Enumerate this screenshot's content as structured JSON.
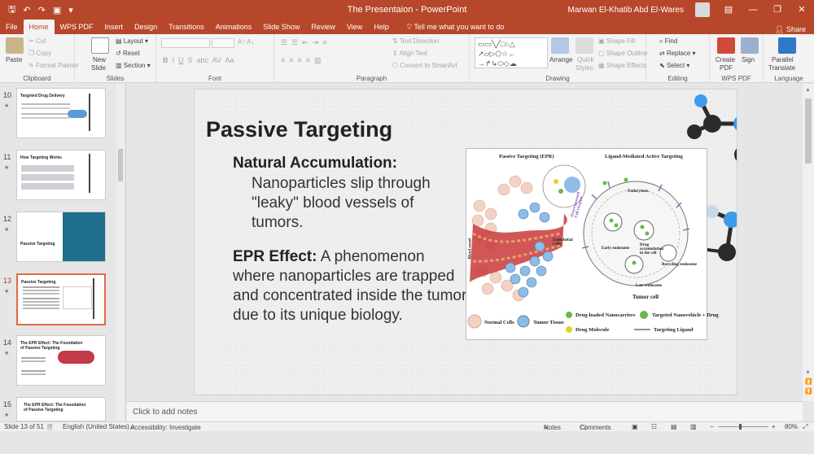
{
  "titlebar": {
    "doc_title": "The Presentaion  -  PowerPoint",
    "user": "Marwan El-Khatib Abd El-Wares",
    "share": "Share"
  },
  "tabs": [
    "File",
    "Home",
    "WPS PDF",
    "Insert",
    "Design",
    "Transitions",
    "Animations",
    "Slide Show",
    "Review",
    "View",
    "Help"
  ],
  "tell_me": "Tell me what you want to do",
  "ribbon": {
    "clipboard": {
      "label": "Clipboard",
      "paste": "Paste",
      "cut": "Cut",
      "copy": "Copy",
      "format_painter": "Format Painter"
    },
    "slides": {
      "label": "Slides",
      "new_slide_1": "New",
      "new_slide_2": "Slide",
      "layout": "Layout",
      "reset": "Reset",
      "section": "Section"
    },
    "font": {
      "label": "Font"
    },
    "paragraph": {
      "label": "Paragraph",
      "text_direction": "Text Direction",
      "align_text": "Align Text",
      "smartart": "Convert to SmartArt"
    },
    "drawing": {
      "label": "Drawing",
      "arrange": "Arrange",
      "quick_styles_1": "Quick",
      "quick_styles_2": "Styles",
      "shape_fill": "Shape Fill",
      "shape_outline": "Shape Outline",
      "shape_effects": "Shape Effects"
    },
    "editing": {
      "label": "Editing",
      "find": "Find",
      "replace": "Replace",
      "select": "Select"
    },
    "wps_pdf": {
      "label": "WPS PDF",
      "create_1": "Create",
      "create_2": "PDF",
      "sign": "Sign"
    },
    "language": {
      "label": "Language",
      "translate_1": "Parallel",
      "translate_2": "Translate"
    }
  },
  "thumbnails": [
    {
      "num": "10",
      "title": "Targeted Drug Delivery"
    },
    {
      "num": "11",
      "title": "How Targeting Works"
    },
    {
      "num": "12",
      "title": "Passive Targeting"
    },
    {
      "num": "13",
      "title": "Passive Targeting"
    },
    {
      "num": "14",
      "title": "The EPR Effect: The Foundation of Passive Targeting"
    },
    {
      "num": "15",
      "title": "The EPR Effect: The Foundation of Passive Targeting"
    }
  ],
  "slide": {
    "title": "Passive Targeting",
    "bullet1_heading": "Natural Accumulation:",
    "bullet1_text": "Nanoparticles slip through \"leaky\" blood vessels of tumors.",
    "bullet2_lead": "EPR Effect:",
    "bullet2_text": " A phenomenon where nanoparticles are trapped and concentrated inside the tumor due to its unique biology.",
    "figure": {
      "left_title": "Passive Targeting (EPR)",
      "right_title": "Ligand-Mediated Active Targeting",
      "endocytosis": "Endocytosis",
      "early_endosome": "Early endosome",
      "drug_accumulation": "Drug accumulation in the cell",
      "recycling_endosome": "Recycling endosome",
      "late_endosome": "Late endosome",
      "tumor_cell": "Tumor cell",
      "endothelial": "Endothelial Cells",
      "blood_vessel": "Blood vessel",
      "overexpressed": "Overexpressed Cell receptor",
      "legend_normal": "Normal Cells",
      "legend_tumor": "Tumor Tissue",
      "legend_loaded": "Drug-loaded Nanocarriers",
      "legend_drug": "Drug Molecule",
      "legend_targeted": "Targeted Nanovehicle + Drug",
      "legend_ligand": "Targeting Ligand"
    }
  },
  "notes_placeholder": "Click to add notes",
  "status": {
    "slide": "Slide 13 of 51",
    "language": "English (United States)",
    "accessibility": "Accessibility: Investigate",
    "notes": "Notes",
    "comments": "Comments",
    "zoom": "80%"
  },
  "colors": {
    "accent": "#b7472a",
    "ribbon_bg": "#f3f3f3",
    "selection": "#e06a45",
    "molecule_dark": "#2b2b2b",
    "molecule_blue": "#3d9be9"
  }
}
